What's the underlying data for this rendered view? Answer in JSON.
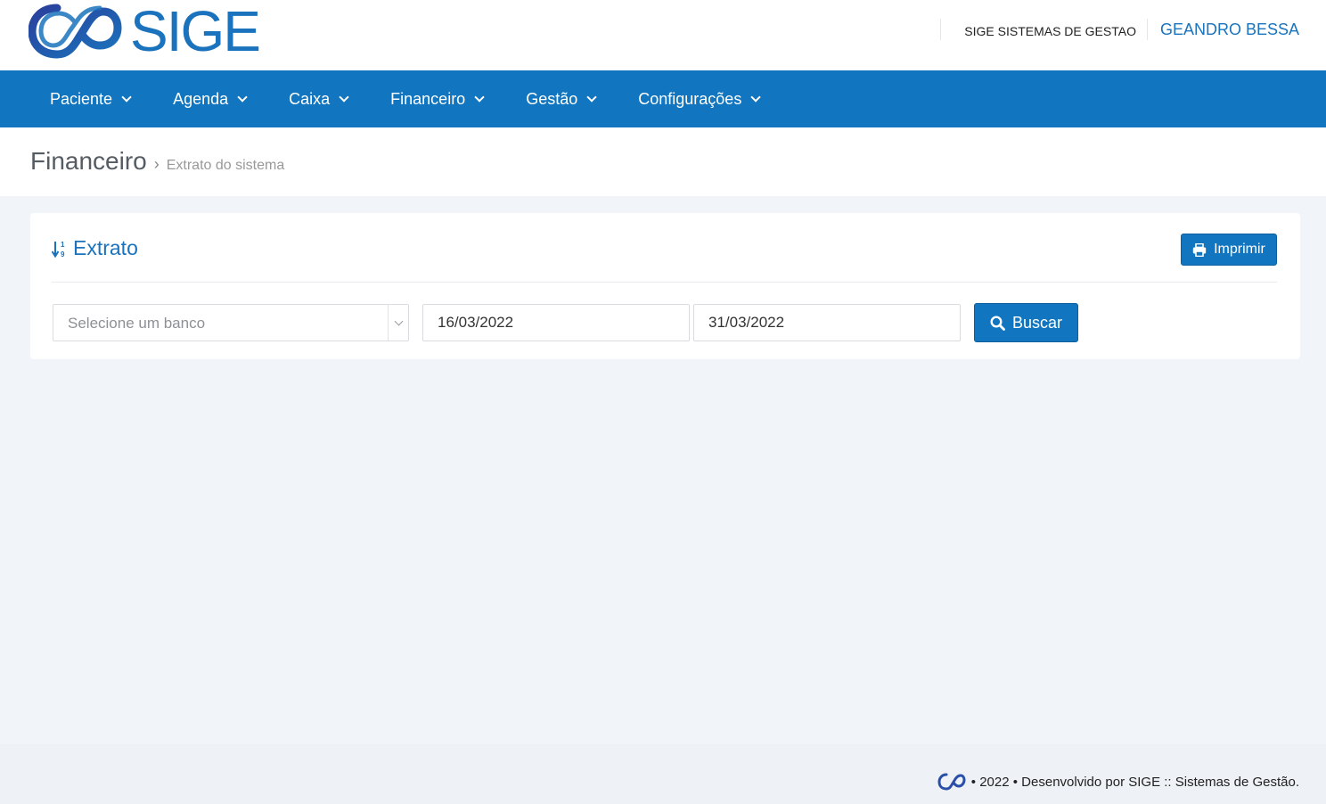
{
  "header": {
    "logo_text": "SIGE",
    "company": "SIGE SISTEMAS DE GESTAO",
    "user": "GEANDRO BESSA",
    "brand_color": "#1175bf"
  },
  "nav": {
    "items": [
      {
        "label": "Paciente"
      },
      {
        "label": "Agenda"
      },
      {
        "label": "Caixa"
      },
      {
        "label": "Financeiro"
      },
      {
        "label": "Gestão"
      },
      {
        "label": "Configurações"
      }
    ]
  },
  "breadcrumb": {
    "section": "Financeiro",
    "separator": "›",
    "page": "Extrato do sistema"
  },
  "card": {
    "title": "Extrato",
    "title_icon": "sort-numeric-icon",
    "print_label": "Imprimir",
    "bank_select": {
      "placeholder": "Selecione um banco"
    },
    "date_start": "16/03/2022",
    "date_end": "31/03/2022",
    "search_label": "Buscar"
  },
  "footer": {
    "text": "• 2022 • Desenvolvido por SIGE :: Sistemas de Gestão."
  }
}
